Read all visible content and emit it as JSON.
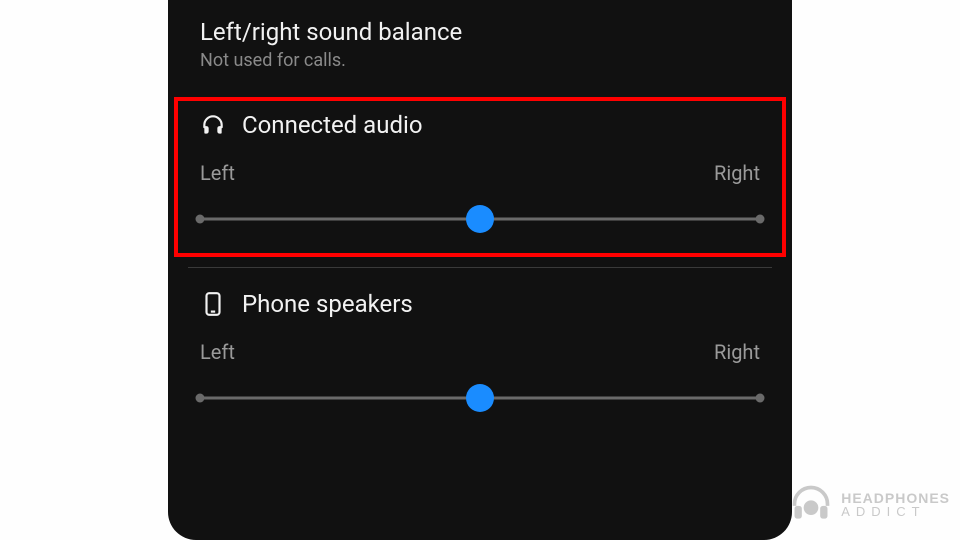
{
  "header": {
    "title": "Left/right sound balance",
    "subtitle": "Not used for calls."
  },
  "sections": {
    "connected": {
      "icon": "headphones-icon",
      "label": "Connected audio",
      "left_label": "Left",
      "right_label": "Right",
      "slider_percent": 50,
      "highlighted": true
    },
    "speakers": {
      "icon": "phone-icon",
      "label": "Phone speakers",
      "left_label": "Left",
      "right_label": "Right",
      "slider_percent": 50,
      "highlighted": false
    }
  },
  "watermark": {
    "line1": "HEADPHONES",
    "line2": "ADDICT"
  },
  "colors": {
    "background": "#111111",
    "slider_thumb": "#1a8cff",
    "highlight": "#ff0000"
  }
}
